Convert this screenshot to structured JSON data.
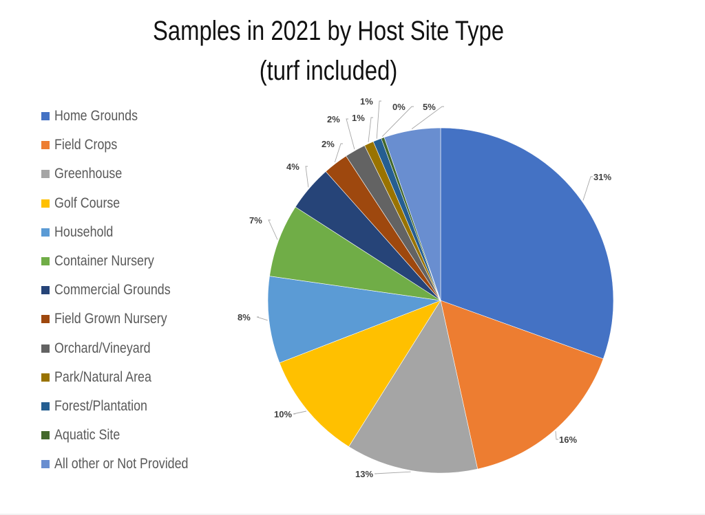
{
  "chart_data": {
    "type": "pie",
    "title": "Samples in 2021 by Host Site Type",
    "subtitle": "(turf included)",
    "legend_position": "left",
    "categories": [
      "Home Grounds",
      "Field Crops",
      "Greenhouse",
      "Golf Course",
      "Household",
      "Container Nursery",
      "Commercial Grounds",
      "Field Grown Nursery",
      "Orchard/Vineyard",
      "Park/Natural Area",
      "Forest/Plantation",
      "Aquatic Site",
      "All other or Not Provided"
    ],
    "values": [
      31.1,
      16.4,
      12.6,
      10.4,
      8.3,
      7.0,
      4.4,
      2.4,
      2.0,
      0.9,
      0.8,
      0.3,
      5.4
    ],
    "data_labels": [
      "31%",
      "16%",
      "13%",
      "10%",
      "8%",
      "7%",
      "4%",
      "2%",
      "2%",
      "1%",
      "1%",
      "0%",
      "5%"
    ],
    "colors": [
      "#4472C4",
      "#ED7D31",
      "#A5A5A5",
      "#FFC000",
      "#5B9BD5",
      "#70AD47",
      "#264478",
      "#9E480E",
      "#636363",
      "#997300",
      "#255E91",
      "#43682B",
      "#698ED0"
    ],
    "start_angle": "12 o'clock",
    "direction": "clockwise"
  }
}
